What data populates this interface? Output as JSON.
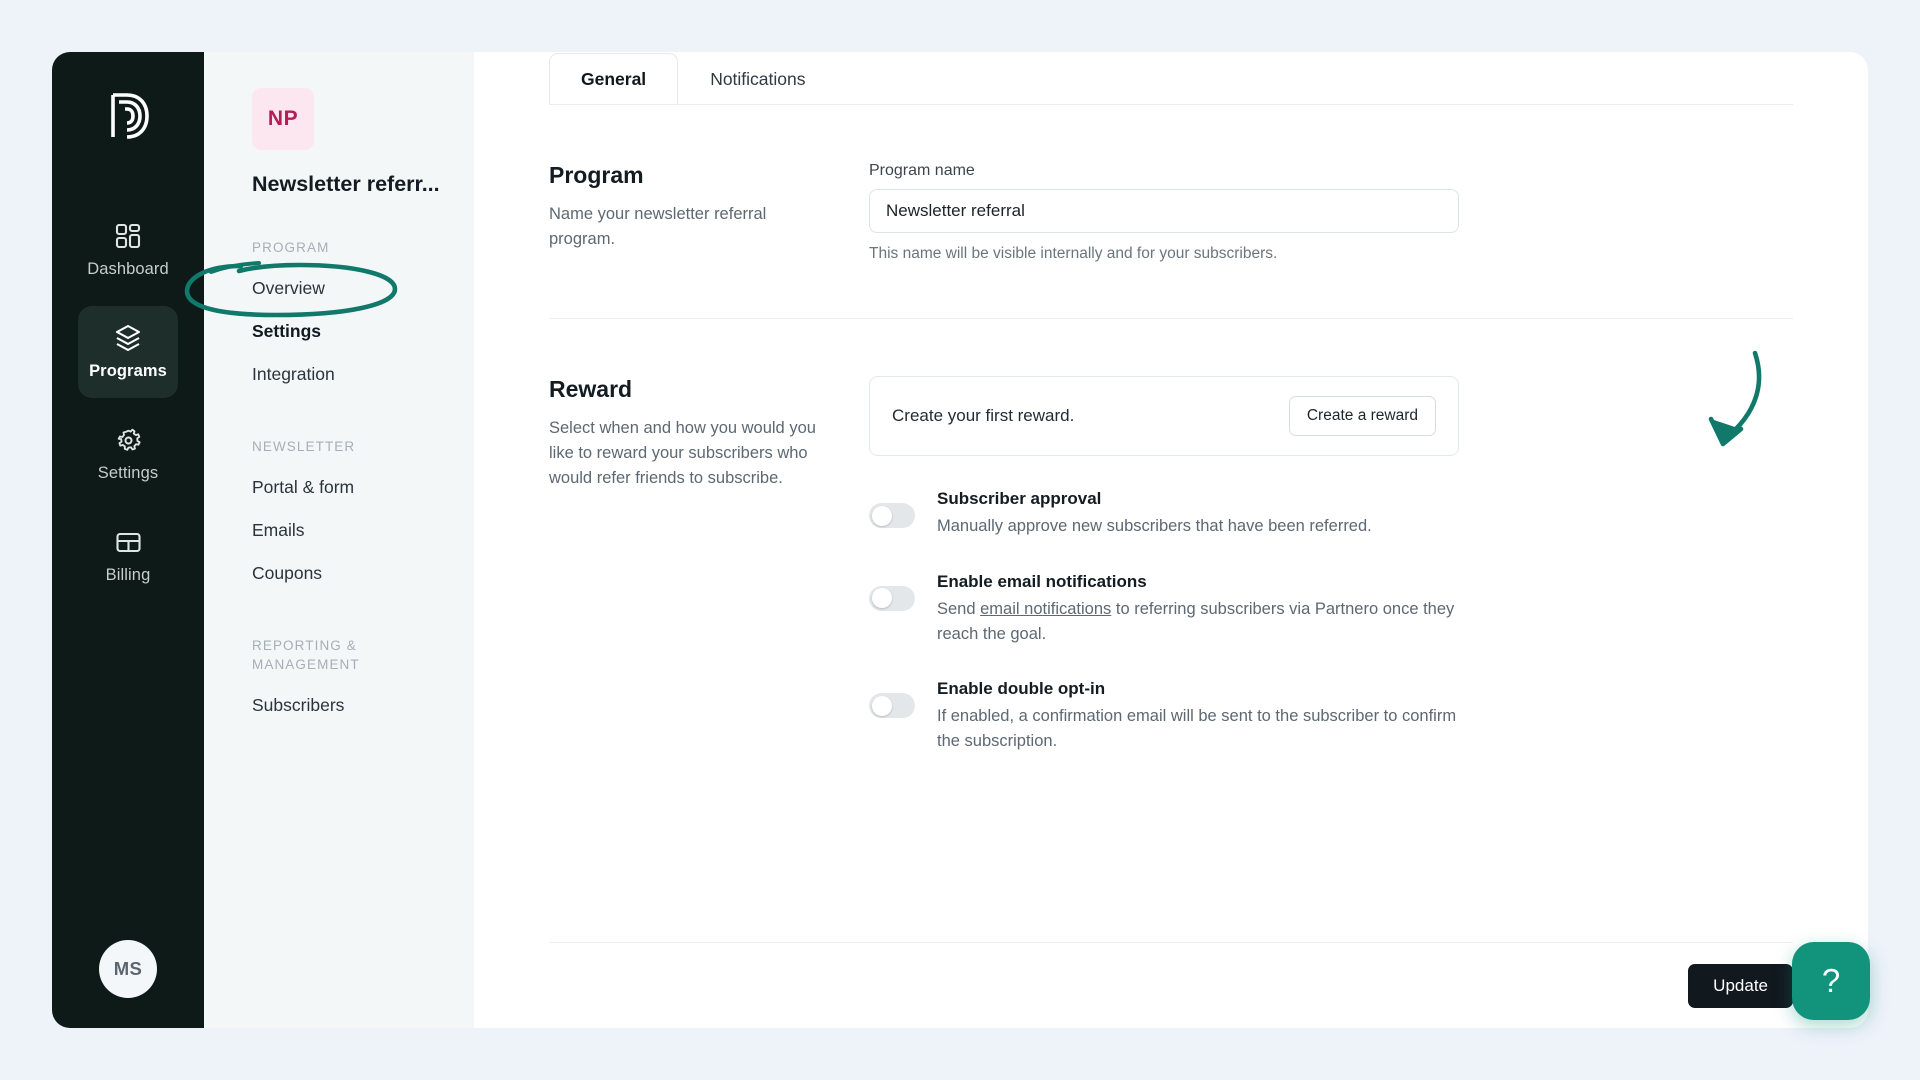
{
  "rail": {
    "logo_icon": "partnero-logo-icon",
    "items": [
      {
        "label": "Dashboard",
        "icon": "grid-icon",
        "active": false
      },
      {
        "label": "Programs",
        "icon": "layers-icon",
        "active": true
      },
      {
        "label": "Settings",
        "icon": "gear-icon",
        "active": false
      },
      {
        "label": "Billing",
        "icon": "card-icon",
        "active": false
      }
    ],
    "avatar_initials": "MS"
  },
  "sidebar": {
    "program_initials": "NP",
    "program_title": "Newsletter referr...",
    "sections": [
      {
        "label": "PROGRAM",
        "items": [
          {
            "label": "Overview",
            "active": false
          },
          {
            "label": "Settings",
            "active": true
          },
          {
            "label": "Integration",
            "active": false
          }
        ]
      },
      {
        "label": "NEWSLETTER",
        "items": [
          {
            "label": "Portal & form",
            "active": false
          },
          {
            "label": "Emails",
            "active": false
          },
          {
            "label": "Coupons",
            "active": false
          }
        ]
      },
      {
        "label": "REPORTING & MANAGEMENT",
        "items": [
          {
            "label": "Subscribers",
            "active": false
          }
        ]
      }
    ]
  },
  "tabs": [
    {
      "label": "General",
      "active": true
    },
    {
      "label": "Notifications",
      "active": false
    }
  ],
  "program_section": {
    "title": "Program",
    "description": "Name your newsletter referral program.",
    "field_label": "Program name",
    "field_value": "Newsletter referral",
    "field_placeholder": "Program name",
    "hint": "This name will be visible internally and for your subscribers."
  },
  "reward_section": {
    "title": "Reward",
    "description": "Select when and how you would you like to reward your subscribers who would refer friends to subscribe.",
    "empty_text": "Create your first reward.",
    "create_button": "Create a reward",
    "toggles": [
      {
        "title": "Subscriber approval",
        "desc_before": "Manually approve new subscribers that have been referred.",
        "link": "",
        "desc_after": "",
        "on": false
      },
      {
        "title": "Enable email notifications",
        "desc_before": "Send ",
        "link": "email notifications",
        "desc_after": " to referring subscribers via Partnero once they reach the goal.",
        "on": false
      },
      {
        "title": "Enable double opt-in",
        "desc_before": "If enabled, a confirmation email will be sent to the subscriber to confirm the subscription.",
        "link": "",
        "desc_after": "",
        "on": false
      }
    ]
  },
  "footer": {
    "update_button": "Update"
  },
  "help": {
    "label": "?"
  },
  "annotations": {
    "circle_color": "#11796a",
    "arrow_color": "#11796a"
  }
}
